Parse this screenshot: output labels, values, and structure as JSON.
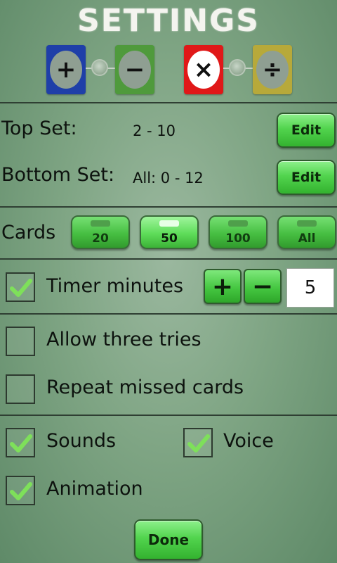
{
  "title": "SETTINGS",
  "operations": [
    {
      "symbol": "+",
      "card_color": "#1f3fa8",
      "oval_color": "#8f9f92",
      "icon": "plus-icon"
    },
    {
      "symbol": "−",
      "card_color": "#4f9a3c",
      "oval_color": "#8f9f92",
      "icon": "minus-icon"
    },
    {
      "symbol": "×",
      "card_color": "#e01818",
      "oval_color": "#ffffff",
      "icon": "times-icon"
    },
    {
      "symbol": "÷",
      "card_color": "#b7a93a",
      "oval_color": "#8f9f92",
      "icon": "divide-icon"
    }
  ],
  "sets": {
    "top": {
      "label": "Top Set:",
      "value": "2 - 10",
      "edit_label": "Edit"
    },
    "bottom": {
      "label": "Bottom Set:",
      "value": "All: 0 - 12",
      "edit_label": "Edit"
    }
  },
  "cards": {
    "label": "Cards",
    "options": [
      "20",
      "50",
      "100",
      "All"
    ],
    "selected": "50"
  },
  "timer": {
    "checked": true,
    "label": "Timer minutes",
    "plus": "+",
    "minus": "−",
    "value": "5"
  },
  "options": {
    "three_tries": {
      "label": "Allow three tries",
      "checked": false
    },
    "repeat_missed": {
      "label": "Repeat missed cards",
      "checked": false
    },
    "sounds": {
      "label": "Sounds",
      "checked": true
    },
    "voice": {
      "label": "Voice",
      "checked": true
    },
    "animation": {
      "label": "Animation",
      "checked": true
    }
  },
  "done_label": "Done",
  "colors": {
    "button_green": "#52d44e",
    "check_green": "#7ee05a",
    "divider": "#2f3f33"
  }
}
